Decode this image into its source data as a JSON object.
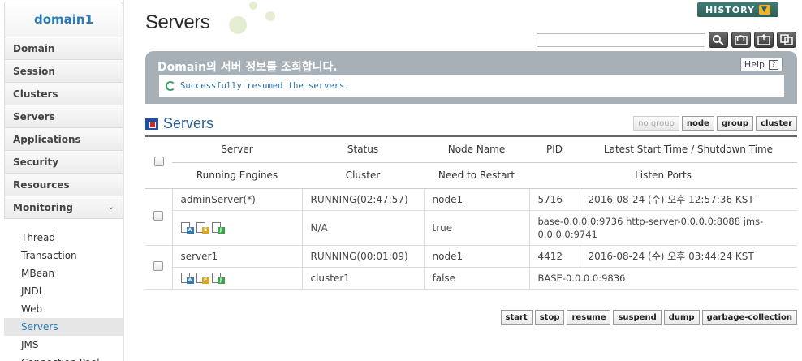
{
  "sidebar": {
    "domain": "domain1",
    "items": [
      {
        "label": "Domain"
      },
      {
        "label": "Session"
      },
      {
        "label": "Clusters"
      },
      {
        "label": "Servers"
      },
      {
        "label": "Applications"
      },
      {
        "label": "Security"
      },
      {
        "label": "Resources"
      },
      {
        "label": "Monitoring"
      }
    ],
    "sub_items": [
      {
        "label": "Thread"
      },
      {
        "label": "Transaction"
      },
      {
        "label": "MBean"
      },
      {
        "label": "JNDI"
      },
      {
        "label": "Web"
      },
      {
        "label": "Servers",
        "active": true
      },
      {
        "label": "JMS"
      },
      {
        "label": "Connection Pool"
      }
    ]
  },
  "header": {
    "title": "Servers",
    "history_label": "HISTORY",
    "search_placeholder": ""
  },
  "info": {
    "title": "Domain의 서버 정보를 조회합니다.",
    "help_label": "Help",
    "status_message": "Successfully resumed the servers."
  },
  "section": {
    "title": "Servers",
    "group_buttons": [
      "no group",
      "node",
      "group",
      "cluster"
    ]
  },
  "table": {
    "headers_row1": [
      "Server",
      "Status",
      "Node Name",
      "PID",
      "Latest Start Time / Shutdown Time"
    ],
    "headers_row2": [
      "Running Engines",
      "Cluster",
      "Need to Restart",
      "Listen Ports"
    ],
    "servers": [
      {
        "name": "adminServer(*)",
        "status": "RUNNING(02:47:57)",
        "node": "node1",
        "pid": "5716",
        "time": "2016-08-24 (수) 오후 12:57:36 KST",
        "cluster": "N/A",
        "need_restart": "true",
        "ports": "base-0.0.0.0:9736 http-server-0.0.0.0:8088 jms-0.0.0.0:9741"
      },
      {
        "name": "server1",
        "status": "RUNNING(00:01:09)",
        "node": "node1",
        "pid": "4412",
        "time": "2016-08-24 (수) 오후 03:44:24 KST",
        "cluster": "cluster1",
        "need_restart": "false",
        "ports": "BASE-0.0.0.0:9836"
      }
    ]
  },
  "actions": [
    "start",
    "stop",
    "resume",
    "suspend",
    "dump",
    "garbage-collection"
  ],
  "colors": {
    "accent": "#2a7bb6",
    "info_box": "#a7b0b6",
    "history": "#2e6059"
  }
}
